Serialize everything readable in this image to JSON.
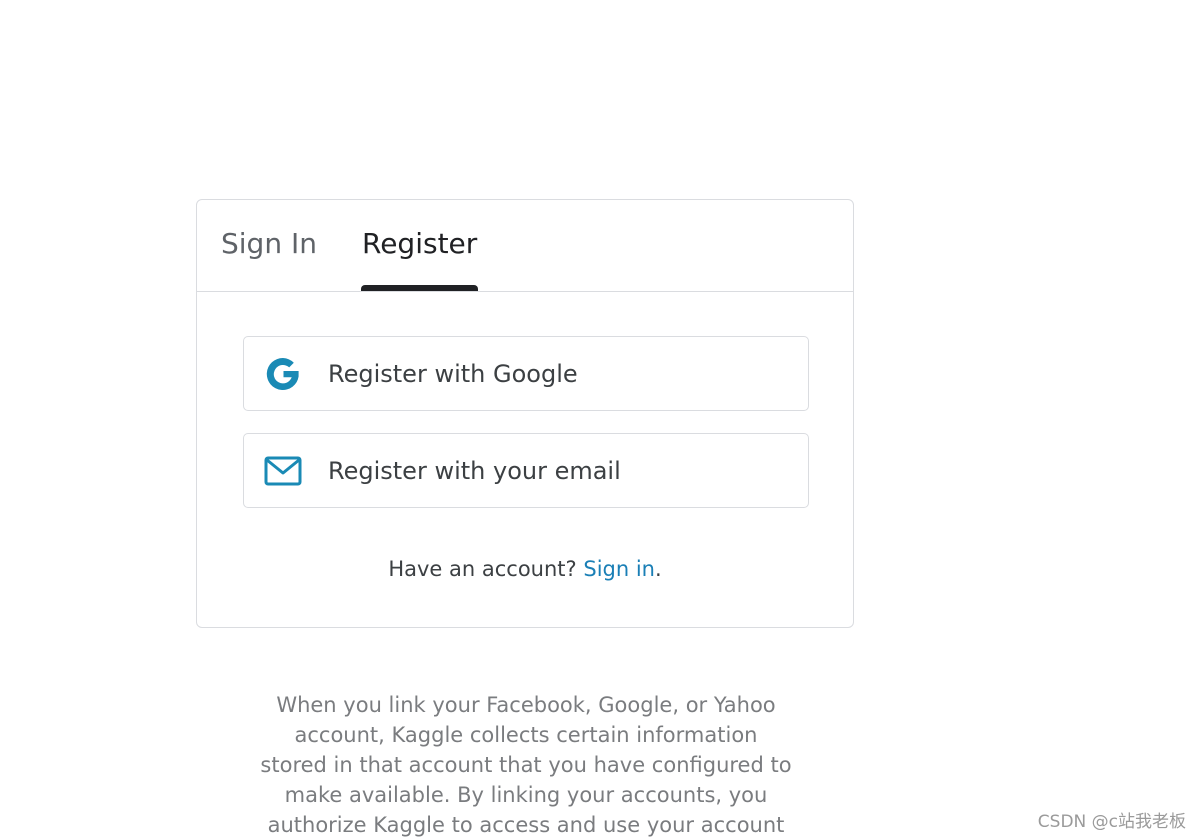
{
  "tabs": {
    "sign_in": "Sign In",
    "register": "Register",
    "active": "register"
  },
  "buttons": {
    "google": {
      "label": "Register with Google",
      "icon": "google-icon"
    },
    "email": {
      "label": "Register with your email",
      "icon": "mail-icon"
    }
  },
  "account_prompt": {
    "text": "Have an account?",
    "link": "Sign in",
    "suffix": "."
  },
  "disclaimer_lines": [
    "When you link your Facebook, Google, or Yahoo",
    "account, Kaggle collects certain information",
    "stored in that account that you have configured to",
    "make available. By linking your accounts, you",
    "authorize Kaggle to access and use your account"
  ],
  "watermark": "CSDN @c站我老板",
  "colors": {
    "accent": "#1a7fb6",
    "icon": "#1a8ab5",
    "border": "#dadce0",
    "text": "#3c4043",
    "muted": "#7a7c7f"
  }
}
